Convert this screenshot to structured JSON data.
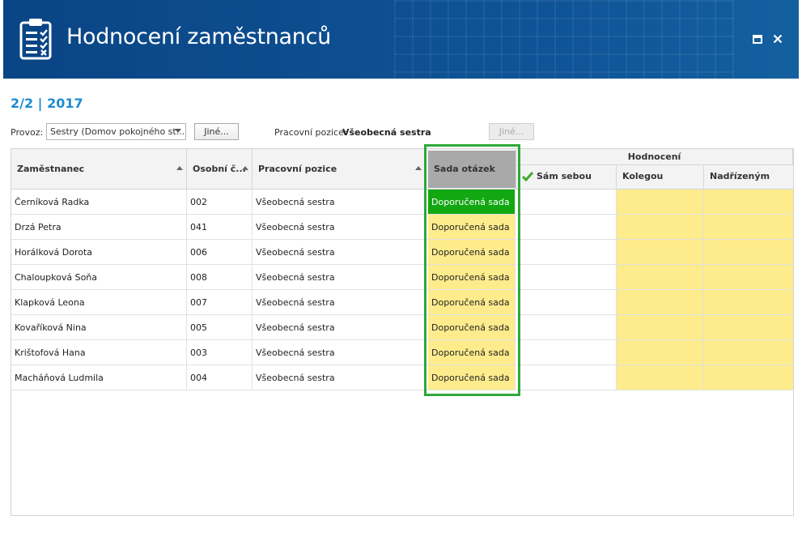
{
  "header": {
    "title": "Hodnocení zaměstnanců",
    "icon": "clipboard-checklist-icon",
    "maximize_icon": "maximize-icon",
    "close_icon": "close-icon",
    "color": "#0d4c8c"
  },
  "period": "2/2 | 2017",
  "filters": {
    "provoz_label": "Provoz:",
    "provoz_value": "Sestry (Domov pokojného st...",
    "jine_button": "Jiné...",
    "position_label": "Pracovní pozice:",
    "position_value": "Všeobecná sestra",
    "jine_button_2": "Jiné..."
  },
  "table": {
    "columns": {
      "employee": "Zaměstnanec",
      "personal_no": "Osobní č...",
      "position": "Pracovní pozice",
      "question_set": "Sada otázek",
      "evaluation_group": "Hodnocení",
      "self": "Sám sebou",
      "colleague": "Kolegou",
      "supervisor": "Nadřízeným"
    },
    "rows": [
      {
        "name": "Černíková Radka",
        "number": "002",
        "position": "Všeobecná sestra",
        "set": "Doporučená sada"
      },
      {
        "name": "Drzá Petra",
        "number": "041",
        "position": "Všeobecná sestra",
        "set": "Doporučená sada"
      },
      {
        "name": "Horálková Dorota",
        "number": "006",
        "position": "Všeobecná sestra",
        "set": "Doporučená sada"
      },
      {
        "name": "Chaloupková Soňa",
        "number": "008",
        "position": "Všeobecná sestra",
        "set": "Doporučená sada"
      },
      {
        "name": "Klapková Leona",
        "number": "007",
        "position": "Všeobecná sestra",
        "set": "Doporučená sada"
      },
      {
        "name": "Kovaříková Nina",
        "number": "005",
        "position": "Všeobecná sestra",
        "set": "Doporučená sada"
      },
      {
        "name": "Krištofová Hana",
        "number": "003",
        "position": "Všeobecná sestra",
        "set": "Doporučená sada"
      },
      {
        "name": "Macháňová Ludmila",
        "number": "004",
        "position": "Všeobecná sestra",
        "set": "Doporučená sada"
      }
    ]
  },
  "colors": {
    "accent": "#1d8bd0",
    "selected_cell": "#12a812",
    "yellow_cell": "#feec8c",
    "highlight_border": "#2fa83b"
  }
}
